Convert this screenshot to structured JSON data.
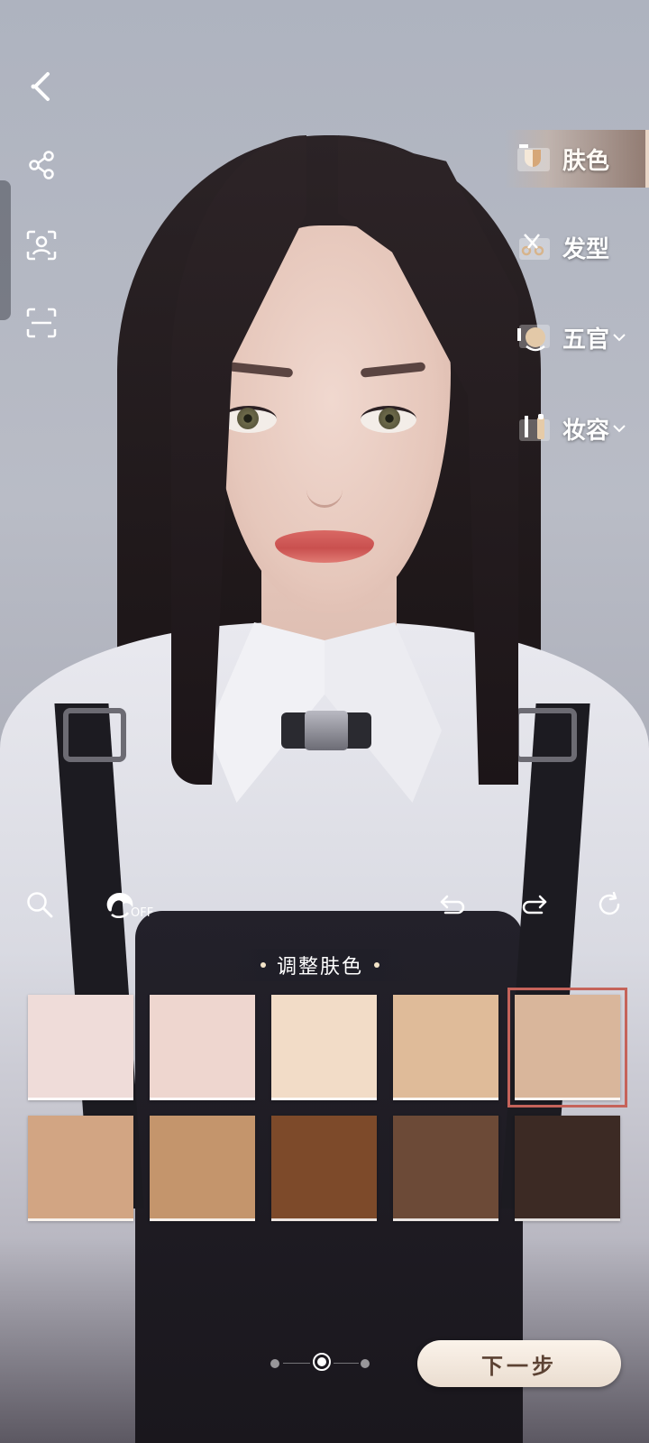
{
  "categories": [
    {
      "label": "肤色",
      "icon": "skin-palette-icon",
      "active": true
    },
    {
      "label": "发型",
      "icon": "scissors-icon",
      "active": false
    },
    {
      "label": "五官",
      "icon": "face-features-icon",
      "active": false
    },
    {
      "label": "妆容",
      "icon": "makeup-icon",
      "active": false
    }
  ],
  "left_icons": [
    "back-arrow-icon",
    "share-icon",
    "face-scan-icon",
    "screenshot-frame-icon"
  ],
  "toolbar": {
    "off_label": "OFF",
    "icons": [
      "search-icon",
      "hair-toggle-icon",
      "undo-icon",
      "redo-icon",
      "reset-icon"
    ]
  },
  "panel": {
    "title": "调整肤色",
    "selected_index": 4,
    "swatches": [
      "#efdcd9",
      "#eed6cf",
      "#f2dcc7",
      "#dfbb99",
      "#d9b69b",
      "#d2a583",
      "#c4956c",
      "#7d4a2a",
      "#6c4a37",
      "#3c2a24"
    ]
  },
  "pager": {
    "pages": 3,
    "current": 2
  },
  "next_label": "下一步",
  "colors": {
    "accent": "#c5635a",
    "button_text": "#5c4233"
  }
}
